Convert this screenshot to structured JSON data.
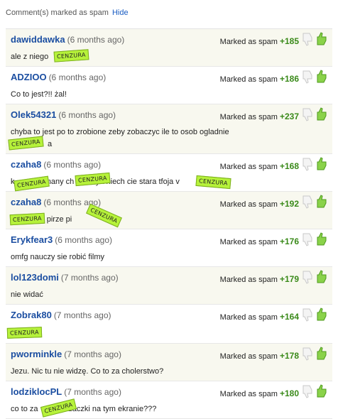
{
  "header": {
    "text": "Comment(s) marked as spam",
    "hide_label": "Hide"
  },
  "stamp_label": "CENZURA",
  "marked_label": "Marked as spam",
  "comments": [
    {
      "user": "dawiddawka",
      "time": "(6 months ago)",
      "text": "ale z niego",
      "score": "+185"
    },
    {
      "user": "ADZIOO",
      "time": "(6 months ago)",
      "text": "Co to jest?!! żal!",
      "score": "+186"
    },
    {
      "user": "Olek54321",
      "time": "(6 months ago)",
      "text": "chyba to jest po to zrobione zeby zobaczyc ile to osob ogladnie",
      "text2": "a",
      "score": "+237"
    },
    {
      "user": "czaha8",
      "time": "(6 months ago)",
      "text": "k          pienany ch          ya niech cie stara tfoja v          o",
      "score": "+168"
    },
    {
      "user": "czaha8",
      "time": "(6 months ago)",
      "text": "           sie pirze pi",
      "score": "+192"
    },
    {
      "user": "Erykfear3",
      "time": "(6 months ago)",
      "text": "omfg nauczy sie robić filmy",
      "score": "+176"
    },
    {
      "user": "lol123domi",
      "time": "(7 months ago)",
      "text": "nie widać",
      "score": "+179"
    },
    {
      "user": "Zobrak80",
      "time": "(7 months ago)",
      "text": "",
      "score": "+164"
    },
    {
      "user": "pworminkle",
      "time": "(7 months ago)",
      "text": "Jezu. Nic tu nie widzę. Co to za cholerstwo?",
      "score": "+178"
    },
    {
      "user": "lodziklocPL",
      "time": "(7 months ago)",
      "text": "co to za           krzaczki na tym ekranie???",
      "score": "+180"
    }
  ]
}
